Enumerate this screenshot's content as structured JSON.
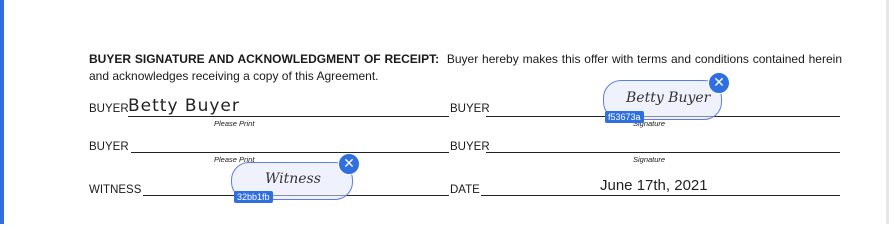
{
  "paragraph": {
    "heading": "BUYER SIGNATURE AND ACKNOWLEDGMENT OF RECEIPT:",
    "body": "Buyer hereby makes this offer with terms and conditions contained herein and acknowledges receiving a copy of this Agreement."
  },
  "rows": {
    "row1_left_label": "BUYER",
    "row1_left_value": "Betty Buyer",
    "row1_left_caption": "Please Print",
    "row1_right_label": "BUYER",
    "row1_right_caption": "Signature",
    "row2_left_label": "BUYER",
    "row2_left_caption": "Please Print",
    "row2_right_label": "BUYER",
    "row2_right_caption": "Signature",
    "row3_left_label": "WITNESS",
    "row3_right_label": "DATE",
    "row3_right_value": "June 17th, 2021"
  },
  "signatures": {
    "buyer_signature_text": "Betty Buyer",
    "buyer_signature_id": "f53673a",
    "witness_signature_text": "Witness",
    "witness_signature_id": "32bb1fb",
    "close_glyph": "✕"
  },
  "colors": {
    "accent": "#2f6fe0",
    "box_border": "#5b7fe0",
    "box_fill": "#e2e8fc"
  }
}
